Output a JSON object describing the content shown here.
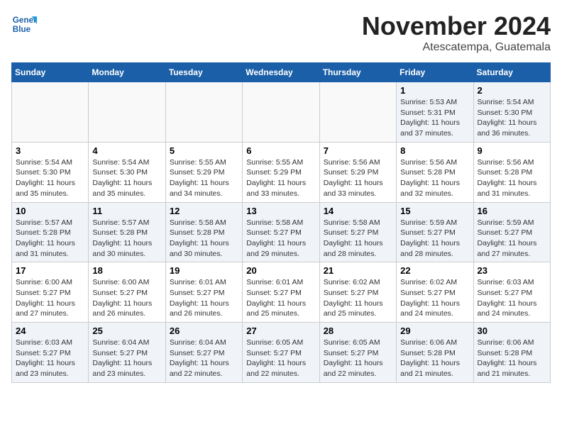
{
  "header": {
    "logo_line1": "General",
    "logo_line2": "Blue",
    "month_title": "November 2024",
    "location": "Atescatempa, Guatemala"
  },
  "weekdays": [
    "Sunday",
    "Monday",
    "Tuesday",
    "Wednesday",
    "Thursday",
    "Friday",
    "Saturday"
  ],
  "weeks": [
    [
      {
        "day": "",
        "info": ""
      },
      {
        "day": "",
        "info": ""
      },
      {
        "day": "",
        "info": ""
      },
      {
        "day": "",
        "info": ""
      },
      {
        "day": "",
        "info": ""
      },
      {
        "day": "1",
        "info": "Sunrise: 5:53 AM\nSunset: 5:31 PM\nDaylight: 11 hours and 37 minutes."
      },
      {
        "day": "2",
        "info": "Sunrise: 5:54 AM\nSunset: 5:30 PM\nDaylight: 11 hours and 36 minutes."
      }
    ],
    [
      {
        "day": "3",
        "info": "Sunrise: 5:54 AM\nSunset: 5:30 PM\nDaylight: 11 hours and 35 minutes."
      },
      {
        "day": "4",
        "info": "Sunrise: 5:54 AM\nSunset: 5:30 PM\nDaylight: 11 hours and 35 minutes."
      },
      {
        "day": "5",
        "info": "Sunrise: 5:55 AM\nSunset: 5:29 PM\nDaylight: 11 hours and 34 minutes."
      },
      {
        "day": "6",
        "info": "Sunrise: 5:55 AM\nSunset: 5:29 PM\nDaylight: 11 hours and 33 minutes."
      },
      {
        "day": "7",
        "info": "Sunrise: 5:56 AM\nSunset: 5:29 PM\nDaylight: 11 hours and 33 minutes."
      },
      {
        "day": "8",
        "info": "Sunrise: 5:56 AM\nSunset: 5:28 PM\nDaylight: 11 hours and 32 minutes."
      },
      {
        "day": "9",
        "info": "Sunrise: 5:56 AM\nSunset: 5:28 PM\nDaylight: 11 hours and 31 minutes."
      }
    ],
    [
      {
        "day": "10",
        "info": "Sunrise: 5:57 AM\nSunset: 5:28 PM\nDaylight: 11 hours and 31 minutes."
      },
      {
        "day": "11",
        "info": "Sunrise: 5:57 AM\nSunset: 5:28 PM\nDaylight: 11 hours and 30 minutes."
      },
      {
        "day": "12",
        "info": "Sunrise: 5:58 AM\nSunset: 5:28 PM\nDaylight: 11 hours and 30 minutes."
      },
      {
        "day": "13",
        "info": "Sunrise: 5:58 AM\nSunset: 5:27 PM\nDaylight: 11 hours and 29 minutes."
      },
      {
        "day": "14",
        "info": "Sunrise: 5:58 AM\nSunset: 5:27 PM\nDaylight: 11 hours and 28 minutes."
      },
      {
        "day": "15",
        "info": "Sunrise: 5:59 AM\nSunset: 5:27 PM\nDaylight: 11 hours and 28 minutes."
      },
      {
        "day": "16",
        "info": "Sunrise: 5:59 AM\nSunset: 5:27 PM\nDaylight: 11 hours and 27 minutes."
      }
    ],
    [
      {
        "day": "17",
        "info": "Sunrise: 6:00 AM\nSunset: 5:27 PM\nDaylight: 11 hours and 27 minutes."
      },
      {
        "day": "18",
        "info": "Sunrise: 6:00 AM\nSunset: 5:27 PM\nDaylight: 11 hours and 26 minutes."
      },
      {
        "day": "19",
        "info": "Sunrise: 6:01 AM\nSunset: 5:27 PM\nDaylight: 11 hours and 26 minutes."
      },
      {
        "day": "20",
        "info": "Sunrise: 6:01 AM\nSunset: 5:27 PM\nDaylight: 11 hours and 25 minutes."
      },
      {
        "day": "21",
        "info": "Sunrise: 6:02 AM\nSunset: 5:27 PM\nDaylight: 11 hours and 25 minutes."
      },
      {
        "day": "22",
        "info": "Sunrise: 6:02 AM\nSunset: 5:27 PM\nDaylight: 11 hours and 24 minutes."
      },
      {
        "day": "23",
        "info": "Sunrise: 6:03 AM\nSunset: 5:27 PM\nDaylight: 11 hours and 24 minutes."
      }
    ],
    [
      {
        "day": "24",
        "info": "Sunrise: 6:03 AM\nSunset: 5:27 PM\nDaylight: 11 hours and 23 minutes."
      },
      {
        "day": "25",
        "info": "Sunrise: 6:04 AM\nSunset: 5:27 PM\nDaylight: 11 hours and 23 minutes."
      },
      {
        "day": "26",
        "info": "Sunrise: 6:04 AM\nSunset: 5:27 PM\nDaylight: 11 hours and 22 minutes."
      },
      {
        "day": "27",
        "info": "Sunrise: 6:05 AM\nSunset: 5:27 PM\nDaylight: 11 hours and 22 minutes."
      },
      {
        "day": "28",
        "info": "Sunrise: 6:05 AM\nSunset: 5:27 PM\nDaylight: 11 hours and 22 minutes."
      },
      {
        "day": "29",
        "info": "Sunrise: 6:06 AM\nSunset: 5:28 PM\nDaylight: 11 hours and 21 minutes."
      },
      {
        "day": "30",
        "info": "Sunrise: 6:06 AM\nSunset: 5:28 PM\nDaylight: 11 hours and 21 minutes."
      }
    ]
  ]
}
